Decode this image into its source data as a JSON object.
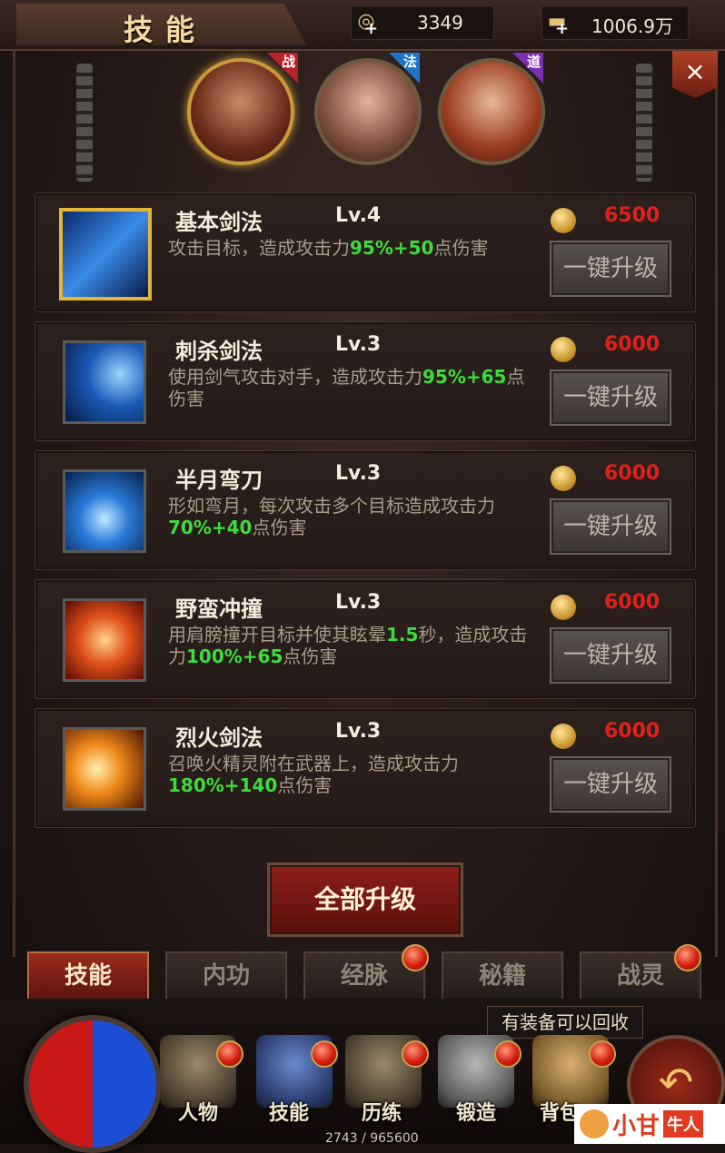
{
  "header": {
    "title": "技能",
    "copper": "3349",
    "gold": "1006.9万",
    "copper_icon": "coin-plus-icon",
    "gold_icon": "gold-ingot-plus-icon",
    "close": "×"
  },
  "characters": [
    {
      "class_tag": "战",
      "tag_color": "#b8202a",
      "active": true
    },
    {
      "class_tag": "法",
      "tag_color": "#1e74c8",
      "active": false
    },
    {
      "class_tag": "道",
      "tag_color": "#7a2fb0",
      "active": false
    }
  ],
  "skills": [
    {
      "name": "基本剑法",
      "level": "Lv.4",
      "desc_pre": "攻击目标，造成攻击力",
      "desc_hl": "95%+50",
      "desc_post": "点伤害",
      "cost": "6500",
      "button": "一键升级",
      "selected": true
    },
    {
      "name": "刺杀剑法",
      "level": "Lv.3",
      "desc_pre": "使用剑气攻击对手，造成攻击力",
      "desc_hl": "95%+65",
      "desc_post": "点伤害",
      "cost": "6000",
      "button": "一键升级"
    },
    {
      "name": "半月弯刀",
      "level": "Lv.3",
      "desc_pre": "形如弯月，每次攻击多个目标造成攻击力",
      "desc_hl": "70%+40",
      "desc_post": "点伤害",
      "cost": "6000",
      "button": "一键升级"
    },
    {
      "name": "野蛮冲撞",
      "level": "Lv.3",
      "desc_pre": "用肩膀撞开目标并使其眩晕",
      "desc_hl1": "1.5",
      "desc_mid": "秒，造成攻击力",
      "desc_hl": "100%+65",
      "desc_post": "点伤害",
      "cost": "6000",
      "button": "一键升级"
    },
    {
      "name": "烈火剑法",
      "level": "Lv.3",
      "desc_pre": "召唤火精灵附在武器上，造成攻击力",
      "desc_hl": "180%+140",
      "desc_post": "点伤害",
      "cost": "6000",
      "button": "一键升级"
    }
  ],
  "all_upgrade": "全部升级",
  "tabs": [
    {
      "label": "技能",
      "active": true,
      "dot": false
    },
    {
      "label": "内功",
      "active": false,
      "dot": false
    },
    {
      "label": "经脉",
      "active": false,
      "dot": true
    },
    {
      "label": "秘籍",
      "active": false,
      "dot": false
    },
    {
      "label": "战灵",
      "active": false,
      "dot": true
    }
  ],
  "bottom_nav": [
    {
      "label": "人物",
      "icon": "helmet-icon"
    },
    {
      "label": "技能",
      "icon": "skill-book-icon"
    },
    {
      "label": "历练",
      "icon": "armor-icon"
    },
    {
      "label": "锻造",
      "icon": "anvil-icon"
    },
    {
      "label": "背包",
      "icon": "bag-icon"
    }
  ],
  "tooltip": "有装备可以回收",
  "exp_text": "2743 / 965600",
  "watermark": {
    "text1": "小甘",
    "text2": "牛人"
  }
}
